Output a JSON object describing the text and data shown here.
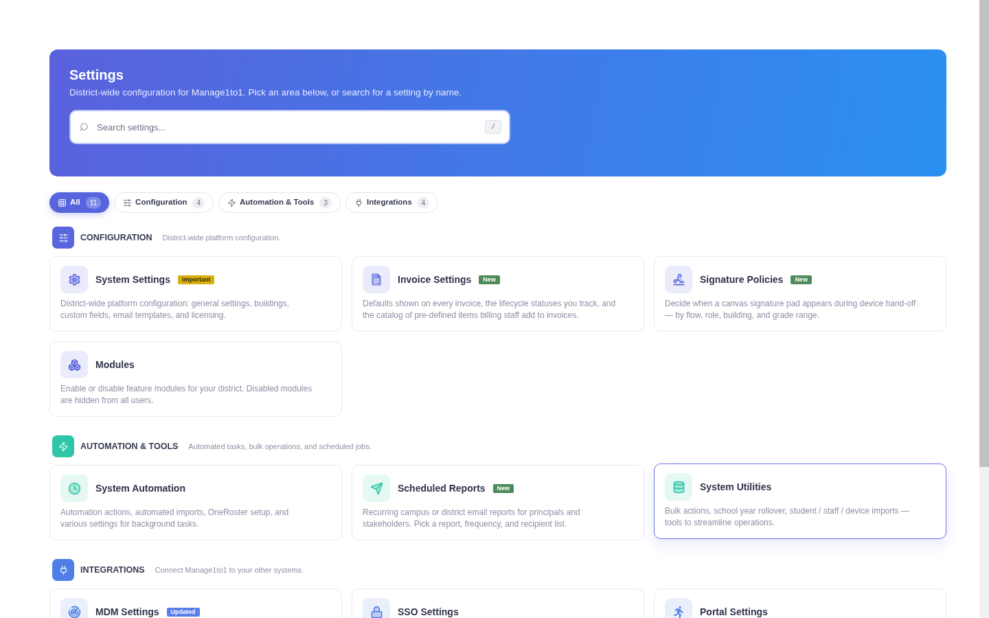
{
  "header": {
    "title": "Settings",
    "subtitle": "District-wide configuration for Manage1to1. Pick an area below, or search for a setting by name.",
    "search": {
      "placeholder": "Search settings...",
      "shortcut": "/"
    }
  },
  "filters": [
    {
      "label": "All",
      "count": "11",
      "selected": true
    },
    {
      "label": "Configuration",
      "count": "4",
      "selected": false
    },
    {
      "label": "Automation & Tools",
      "count": "3",
      "selected": false
    },
    {
      "label": "Integrations",
      "count": "4",
      "selected": false
    }
  ],
  "sections": [
    {
      "title": "CONFIGURATION",
      "description": "District-wide platform configuration.",
      "color": "#5a66dd",
      "cards": [
        {
          "title": "System Settings",
          "badge": {
            "kind": "important",
            "label": "Important"
          },
          "description": "District-wide platform configuration: general settings, buildings, custom fields, email templates, and licensing.",
          "highlighted": false
        },
        {
          "title": "Invoice Settings",
          "badge": {
            "kind": "new",
            "label": "New"
          },
          "description": "Defaults shown on every invoice, the lifecycle statuses you track, and the catalog of pre-defined items billing staff add to invoices.",
          "highlighted": false
        },
        {
          "title": "Signature Policies",
          "badge": {
            "kind": "new",
            "label": "New"
          },
          "description": "Decide when a canvas signature pad appears during device hand-off — by flow, role, building, and grade range.",
          "highlighted": false
        },
        {
          "title": "Modules",
          "description": "Enable or disable feature modules for your district. Disabled modules are hidden from all users.",
          "highlighted": false
        }
      ]
    },
    {
      "title": "AUTOMATION & TOOLS",
      "description": "Automated tasks, bulk operations, and scheduled jobs.",
      "color": "#2dc7a7",
      "cards": [
        {
          "title": "System Automation",
          "description": "Automation actions, automated imports, OneRoster setup, and various settings for background tasks.",
          "highlighted": false
        },
        {
          "title": "Scheduled Reports",
          "badge": {
            "kind": "new",
            "label": "New"
          },
          "description": "Recurring campus or district email reports for principals and stakeholders. Pick a report, frequency, and recipient list.",
          "highlighted": false
        },
        {
          "title": "System Utilities",
          "description": "Bulk actions, school year rollover, student / staff / device imports — tools to streamline operations.",
          "highlighted": true
        }
      ]
    },
    {
      "title": "INTEGRATIONS",
      "description": "Connect Manage1to1 to your other systems.",
      "color": "#4f7fe6",
      "cards": [
        {
          "title": "MDM Settings",
          "badge": {
            "kind": "updated",
            "label": "Updated"
          },
          "highlighted": false
        },
        {
          "title": "SSO Settings",
          "highlighted": false
        },
        {
          "title": "Portal Settings",
          "highlighted": false
        }
      ]
    }
  ]
}
